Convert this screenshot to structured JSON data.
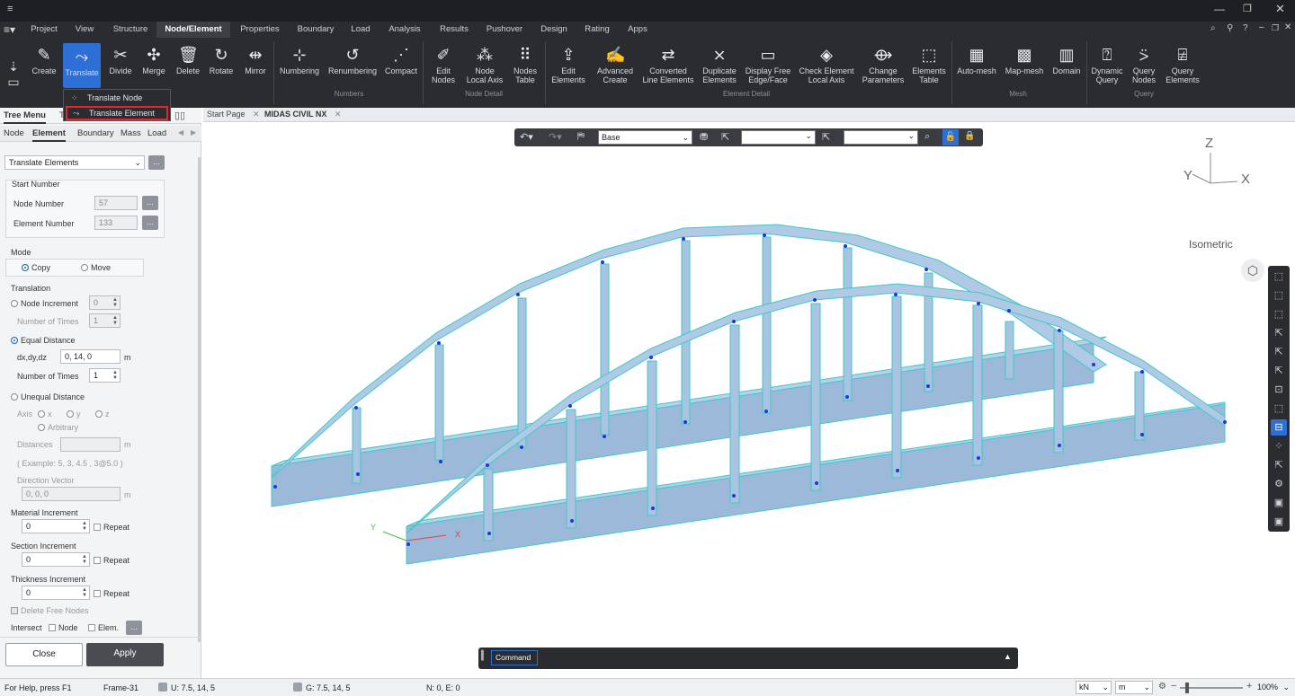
{
  "menu": [
    "Project",
    "View",
    "Structure",
    "Node/Element",
    "Properties",
    "Boundary",
    "Load",
    "Analysis",
    "Results",
    "Pushover",
    "Design",
    "Rating",
    "Apps"
  ],
  "ribbon": {
    "buttons": [
      {
        "label": "Create",
        "icon": "pencil-icon"
      },
      {
        "label": "Translate",
        "icon": "translate-icon"
      },
      {
        "label": "Divide",
        "icon": "divide-icon"
      },
      {
        "label": "Merge",
        "icon": "merge-icon"
      },
      {
        "label": "Delete",
        "icon": "trash-icon"
      },
      {
        "label": "Rotate",
        "icon": "rotate-icon"
      },
      {
        "label": "Mirror",
        "icon": "mirror-icon"
      },
      {
        "label": "Numbering",
        "icon": "numbering-icon"
      },
      {
        "label": "Renumbering",
        "icon": "renumbering-icon"
      },
      {
        "label": "Compact",
        "icon": "compact-icon"
      },
      {
        "label": "Edit\nNodes",
        "icon": "edit-nodes-icon"
      },
      {
        "label": "Node\nLocal Axis",
        "icon": "node-axis-icon"
      },
      {
        "label": "Nodes\nTable",
        "icon": "nodes-table-icon"
      },
      {
        "label": "Edit\nElements",
        "icon": "edit-elements-icon"
      },
      {
        "label": "Advanced\nCreate",
        "icon": "advanced-create-icon"
      },
      {
        "label": "Converted\nLine Elements",
        "icon": "converted-icon"
      },
      {
        "label": "Duplicate\nElements",
        "icon": "duplicate-icon"
      },
      {
        "label": "Display Free\nEdge/Face",
        "icon": "free-edge-icon"
      },
      {
        "label": "Check Element\nLocal Axis",
        "icon": "check-axis-icon"
      },
      {
        "label": "Change\nParameters",
        "icon": "change-params-icon"
      },
      {
        "label": "Elements\nTable",
        "icon": "elements-table-icon"
      },
      {
        "label": "Auto-mesh",
        "icon": "auto-mesh-icon"
      },
      {
        "label": "Map-mesh",
        "icon": "map-mesh-icon"
      },
      {
        "label": "Domain",
        "icon": "domain-icon"
      },
      {
        "label": "Dynamic\nQuery",
        "icon": "dynamic-query-icon"
      },
      {
        "label": "Query\nNodes",
        "icon": "query-nodes-icon"
      },
      {
        "label": "Query\nElements",
        "icon": "query-elements-icon"
      }
    ],
    "groups": [
      "Numbers",
      "Node Detail",
      "Element Detail",
      "Mesh",
      "Query"
    ]
  },
  "dropdown": {
    "items": [
      "Translate Node",
      "Translate Element"
    ]
  },
  "left_panel": {
    "header_tabs": [
      "Tree Menu",
      "T"
    ],
    "tabs": [
      "Node",
      "Element",
      "Boundary",
      "Mass",
      "Load"
    ],
    "function_select": "Translate Elements",
    "start_number": {
      "title": "Start Number",
      "node_label": "Node Number",
      "node_value": "57",
      "element_label": "Element Number",
      "element_value": "133"
    },
    "mode": {
      "title": "Mode",
      "copy": "Copy",
      "move": "Move"
    },
    "translation": {
      "title": "Translation",
      "node_increment": "Node Increment",
      "node_increment_value": "0",
      "number_of_times": "Number of Times",
      "number_of_times_value": "1",
      "equal_distance": "Equal Distance",
      "dxdydz_label": "dx,dy,dz",
      "dxdydz_value": "0, 14, 0",
      "unit": "m",
      "eq_times_label": "Number of Times",
      "eq_times_value": "1",
      "unequal_distance": "Unequal Distance",
      "axis_label": "Axis",
      "ax_x": "x",
      "ax_y": "y",
      "ax_z": "z",
      "arbitrary": "Arbitrary",
      "distances_label": "Distances",
      "distances_unit": "m",
      "example": "( Example: 5, 3, 4.5 , 3@5.0 )",
      "direction_label": "Direction Vector",
      "direction_value": "0, 0, 0",
      "direction_unit": "m"
    },
    "material_increment": "Material Increment",
    "material_value": "0",
    "section_increment": "Section Increment",
    "section_value": "0",
    "thickness_increment": "Thickness Increment",
    "thickness_value": "0",
    "repeat": "Repeat",
    "delete_free_nodes": "Delete Free Nodes",
    "intersect": "Intersect",
    "intersect_node": "Node",
    "intersect_elem": "Elem.",
    "close": "Close",
    "apply": "Apply"
  },
  "doc_tabs": [
    "Start Page",
    "MIDAS CIVIL NX"
  ],
  "view_toolbar": {
    "base": "Base"
  },
  "view_label": "Isometric",
  "axes": {
    "z": "Z",
    "y": "Y",
    "x": "X"
  },
  "local_axes": {
    "y": "Y",
    "x": "X"
  },
  "command": {
    "label": "Command"
  },
  "status": {
    "help": "For Help, press F1",
    "frame": "Frame-31",
    "u": "U: 7.5, 14, 5",
    "g": "G: 7.5, 14, 5",
    "ne": "N: 0, E: 0",
    "force_unit": "kN",
    "length_unit": "m",
    "zoom": "100%"
  },
  "colors": {
    "accent": "#2e6fd6",
    "highlight": "#e3262e",
    "bridge_fill": "#a9c3e0",
    "bridge_stroke": "#3fc9c9",
    "node": "#1a3ad6"
  }
}
